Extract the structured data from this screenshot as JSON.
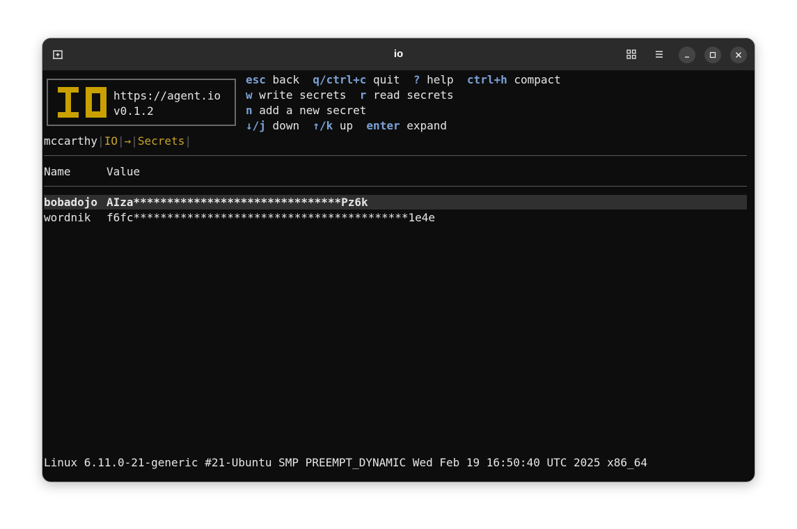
{
  "window": {
    "title": "io"
  },
  "logo": {
    "url": "https://agent.io",
    "version": "v0.1.2"
  },
  "help": {
    "row1": [
      {
        "key": "esc",
        "label": "back"
      },
      {
        "key": "q/ctrl+c",
        "label": "quit"
      },
      {
        "key": "?",
        "label": "help"
      },
      {
        "key": "ctrl+h",
        "label": "compact"
      }
    ],
    "row2": [
      {
        "key": "w",
        "label": "write secrets"
      },
      {
        "key": "r",
        "label": "read secrets"
      }
    ],
    "row3": [
      {
        "key": "n",
        "label": "add a new secret"
      }
    ],
    "row4": [
      {
        "key": "↓/j",
        "label": "down"
      },
      {
        "key": "↑/k",
        "label": "up"
      },
      {
        "key": "enter",
        "label": "expand"
      }
    ]
  },
  "breadcrumb": {
    "user": "mccarthy",
    "app": "IO",
    "arrow": "→",
    "page": "Secrets",
    "sep": "|"
  },
  "table": {
    "columns": [
      "Name",
      "Value"
    ],
    "rows": [
      {
        "name": "bobadojo",
        "value": "AIza*******************************Pz6k"
      },
      {
        "name": "wordnik",
        "value": "f6fc*****************************************1e4e"
      }
    ]
  },
  "status": "Linux 6.11.0-21-generic #21-Ubuntu SMP PREEMPT_DYNAMIC Wed Feb 19 16:50:40 UTC 2025 x86_64",
  "colors": {
    "key": "#7aa2d6",
    "gold": "#c9a227",
    "logo": "#c9a000",
    "selection": "#303030"
  }
}
